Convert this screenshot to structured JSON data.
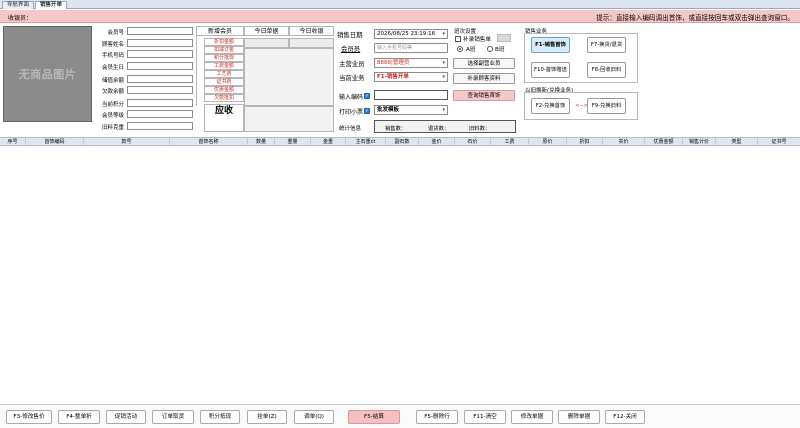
{
  "tabs": [
    "导航界面",
    "销售开单"
  ],
  "tip": {
    "left": "收银员：",
    "right": "提示：直接输入编码调出首饰，或直接按回车或双击弹出查询窗口。"
  },
  "photo_text": "无商品图片",
  "member": {
    "labels": [
      "会员号",
      "顾客姓名",
      "手机号码",
      "会员生日",
      "储值余额",
      "欠款余额",
      "当前积分",
      "会员等级",
      "旧料克重"
    ]
  },
  "stats": {
    "headers": [
      "新增会员",
      "今日单据",
      "今日收银"
    ],
    "rows": [
      "折扣金额",
      "扣减订金",
      "积分抵现",
      "工费金额",
      "工艺费",
      "证书费",
      "优惠金额",
      "欠款抵扣"
    ],
    "yingshou": "应收"
  },
  "sale": {
    "date_label": "销售日期",
    "date_value": "2026/08/25 23:19:16",
    "member_label": "会员员",
    "member_placeholder": "输入手机号码等",
    "main_label": "主营业员",
    "main_value": "8888|管理员",
    "current_label": "当前业务",
    "current_value": "F1-销售开单",
    "input_label": "输入编码",
    "print_label": "打印小票",
    "print_value": "批发模板",
    "stat_label": "统计信息",
    "counts": [
      "销售数：",
      "退货数：",
      "旧料数："
    ]
  },
  "classes": {
    "title": "班次设置",
    "check_label": "补录销售单",
    "radio_a": "A班",
    "radio_b": "B班",
    "btn1": "选择副营业员",
    "btn2": "补录顾客资料",
    "btn3": "查询销售首饰"
  },
  "biz": {
    "title": "销售业务",
    "buttons": [
      "F1-销售首饰",
      "F7-换货/退货",
      "F10-首饰赠送",
      "F8-回收旧料"
    ],
    "title2": "以旧换新(兑换业务)",
    "buttons2": [
      "F2-兑换首饰",
      "F9-兑换旧料"
    ],
    "arrow": "<-->"
  },
  "columns": [
    "序号",
    "首饰编码",
    "款号",
    "首饰名称",
    "数量",
    "重量",
    "金重",
    "主石重ct",
    "副石数",
    "金价",
    "石价",
    "工费",
    "原价",
    "折扣",
    "实价",
    "优惠金额",
    "销售计价",
    "类型",
    "证书号"
  ],
  "footer": [
    "F3-修改售价",
    "F4-整单折",
    "促销活动",
    "订单取货",
    "积分抵现",
    "挂单(Z)",
    "调单(Q)",
    "F5-结算",
    "F5-删除行",
    "F11-清空",
    "修改单据",
    "删除单据",
    "F12-关闭"
  ],
  "colors": {
    "pink": "#f5c8c8",
    "red": "#d4281e",
    "blue": "#2a7de1"
  }
}
